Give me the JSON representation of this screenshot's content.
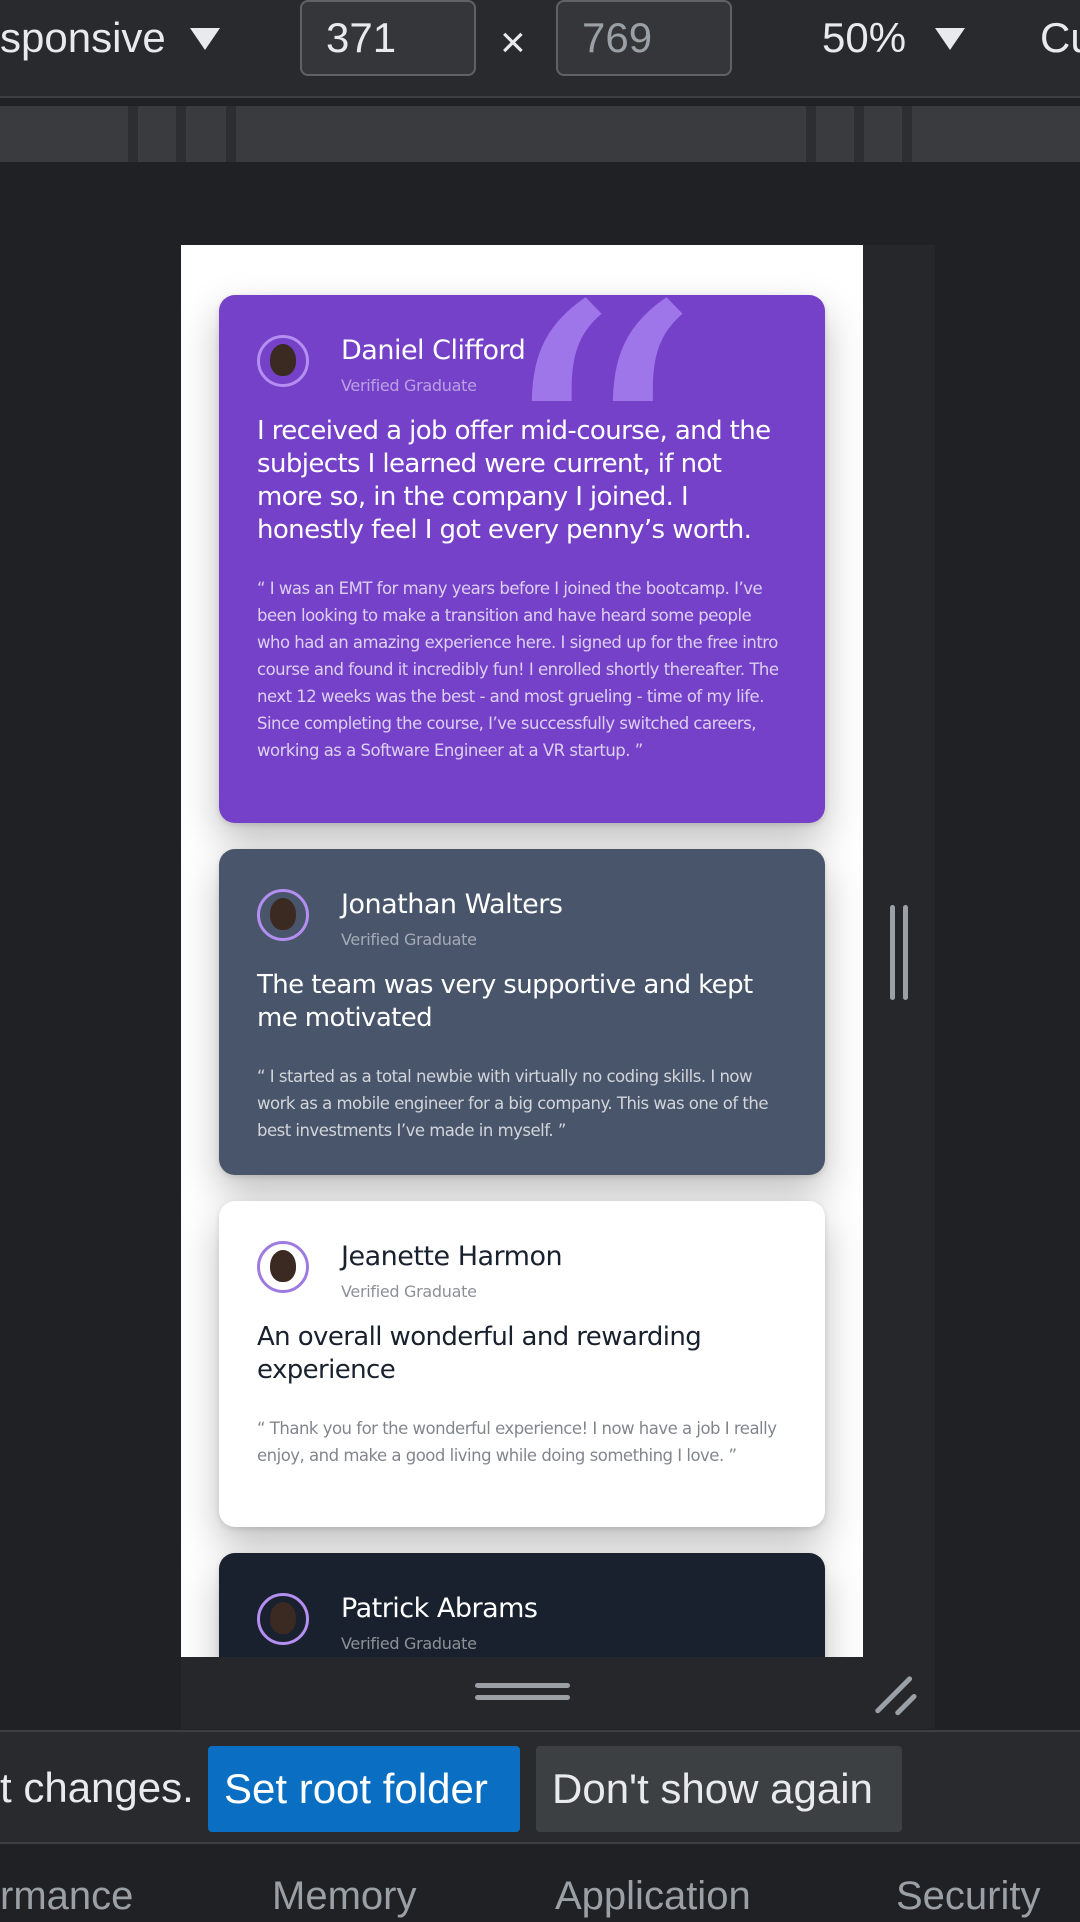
{
  "toolbar": {
    "device_label": "sponsive",
    "width_value": "371",
    "times_sign": "×",
    "height_placeholder": "769",
    "zoom_label": "50%",
    "throttle_label": "Cu"
  },
  "viewport": {
    "cards": [
      {
        "name": "Daniel Clifford",
        "role": "Verified Graduate",
        "headline": "I received a job offer mid-course, and the subjects I learned were current, if not more so, in the company I joined. I honestly feel I got every penny’s worth.",
        "body": "“ I was an EMT for many years before I joined the bootcamp. I’ve been looking to make a transition and have heard some people who had an amazing experience here. I signed up for the free intro course and found it incredibly fun! I enrolled shortly thereafter. The next 12 weeks was the best - and most grueling - time of my life. Since completing the course, I’ve successfully switched careers, working as a Software Engineer at a VR startup. ”",
        "quote_glyph": "“"
      },
      {
        "name": "Jonathan Walters",
        "role": "Verified Graduate",
        "headline": "The team was very supportive and kept me motivated",
        "body": "“ I started as a total newbie with virtually no coding skills. I now work as a mobile engineer for a big company. This was one of the best investments I’ve made in myself. ”"
      },
      {
        "name": "Jeanette Harmon",
        "role": "Verified Graduate",
        "headline": "An overall wonderful and rewarding experience",
        "body": "“ Thank you for the wonderful experience! I now have a job I really enjoy, and make a good living while doing something I love. ”"
      },
      {
        "name": "Patrick Abrams",
        "role": "Verified Graduate"
      }
    ]
  },
  "infobar": {
    "text": "t changes.",
    "set_root_label": "Set root folder",
    "dont_show_label": "Don't show again"
  },
  "tabs": [
    "rmance",
    "Memory",
    "Application",
    "Security"
  ],
  "colors": {
    "card1_bg": "#7541c8",
    "card2_bg": "#48556a",
    "card3_bg": "#ffffff",
    "card4_bg": "#19212e",
    "primary_button": "#0a6fc2"
  }
}
